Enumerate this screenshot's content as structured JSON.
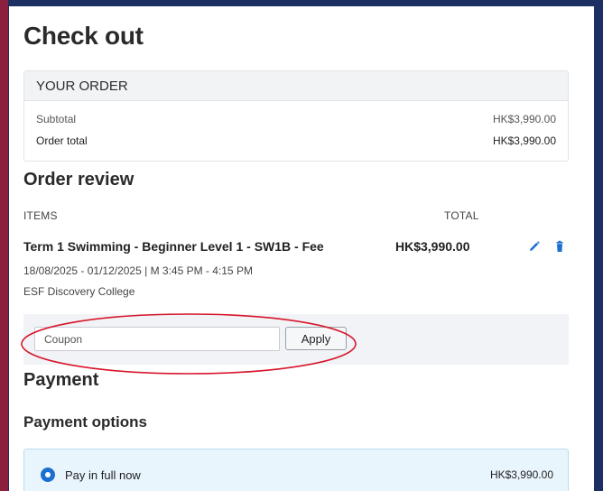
{
  "page_title": "Check out",
  "order_summary": {
    "heading": "YOUR ORDER",
    "subtotal_label": "Subtotal",
    "subtotal_value": "HK$3,990.00",
    "total_label": "Order total",
    "total_value": "HK$3,990.00"
  },
  "order_review": {
    "heading": "Order review",
    "col_items": "ITEMS",
    "col_total": "TOTAL",
    "item": {
      "name": "Term 1 Swimming - Beginner Level 1 - SW1B - Fee",
      "price": "HK$3,990.00",
      "schedule": "18/08/2025 - 01/12/2025 | M 3:45 PM - 4:15 PM",
      "venue": "ESF Discovery College"
    }
  },
  "coupon": {
    "placeholder": "Coupon",
    "apply_label": "Apply"
  },
  "payment": {
    "heading": "Payment",
    "options_heading": "Payment options",
    "option_label": "Pay in full now",
    "option_amount": "HK$3,990.00",
    "selected": true
  },
  "colors": {
    "page_bg": "#1c2f62",
    "left_stripe": "#8d1f3e",
    "accent_blue": "#1b6fd1",
    "annotation_red": "#d8152b"
  },
  "icons": [
    "edit-pencil-icon",
    "trash-icon"
  ]
}
